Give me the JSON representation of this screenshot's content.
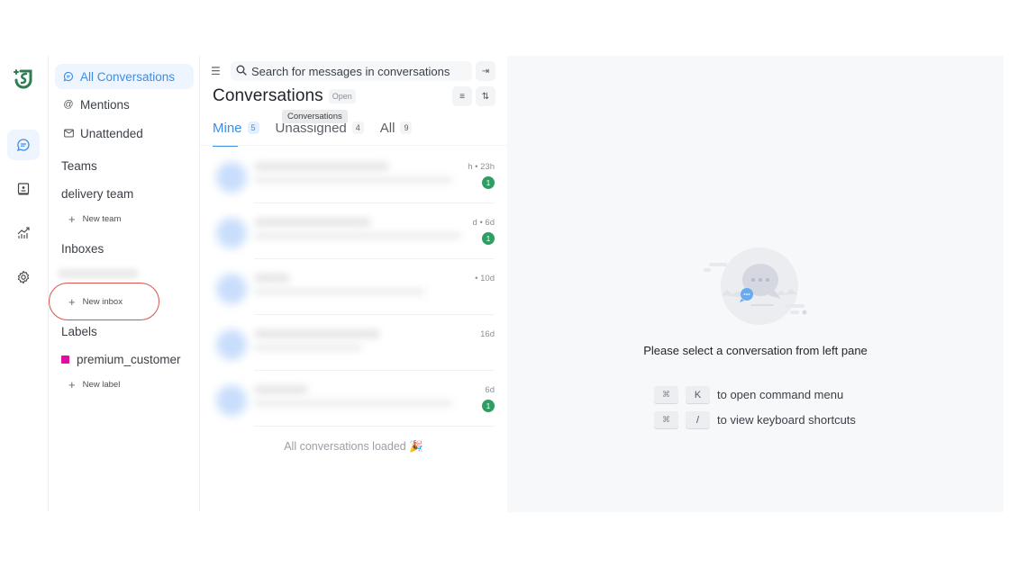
{
  "rail": {
    "logo": "chatwoot-logo",
    "items": [
      {
        "icon": "chat-bubble-icon",
        "active": true
      },
      {
        "icon": "contact-book-icon",
        "active": false
      },
      {
        "icon": "reports-chart-icon",
        "active": false
      },
      {
        "icon": "settings-gear-icon",
        "active": false
      }
    ]
  },
  "sidebar": {
    "nav": [
      {
        "label": "All Conversations",
        "icon": "chat-bubble-icon",
        "active": true
      },
      {
        "label": "Mentions",
        "icon": "at-sign-icon",
        "active": false
      },
      {
        "label": "Unattended",
        "icon": "envelope-icon",
        "active": false
      }
    ],
    "teams_title": "Teams",
    "teams": [
      "delivery team"
    ],
    "new_team": "New team",
    "inboxes_title": "Inboxes",
    "new_inbox": "New inbox",
    "labels_title": "Labels",
    "labels": [
      {
        "name": "premium_customer",
        "color": "#e10ea0"
      }
    ],
    "new_label": "New label"
  },
  "list": {
    "search_placeholder": "Search for messages in conversations",
    "title": "Conversations",
    "status_badge": "Open",
    "tooltip": "Conversations",
    "tabs": [
      {
        "label": "Mine",
        "count": "5",
        "active": true
      },
      {
        "label": "Unassigned",
        "count": "4",
        "active": false
      },
      {
        "label": "All",
        "count": "9",
        "active": false
      }
    ],
    "conversations": [
      {
        "time": "h • 23h",
        "unread": "1"
      },
      {
        "time": "d • 6d",
        "unread": "1"
      },
      {
        "time": "• 10d",
        "unread": null
      },
      {
        "time": "16d",
        "unread": null
      },
      {
        "time": "6d",
        "unread": "1"
      }
    ],
    "footer": "All conversations loaded 🎉"
  },
  "detail": {
    "empty_message": "Please select a conversation from left pane",
    "shortcuts": [
      {
        "mod": "⌘",
        "key": "K",
        "desc": "to open command menu"
      },
      {
        "mod": "⌘",
        "key": "/",
        "desc": "to view keyboard shortcuts"
      }
    ]
  },
  "colors": {
    "accent": "#3b8ee4",
    "unread_badge": "#2f9e62",
    "logo_green": "#2e7d52",
    "highlight_ring": "#d9534f"
  }
}
